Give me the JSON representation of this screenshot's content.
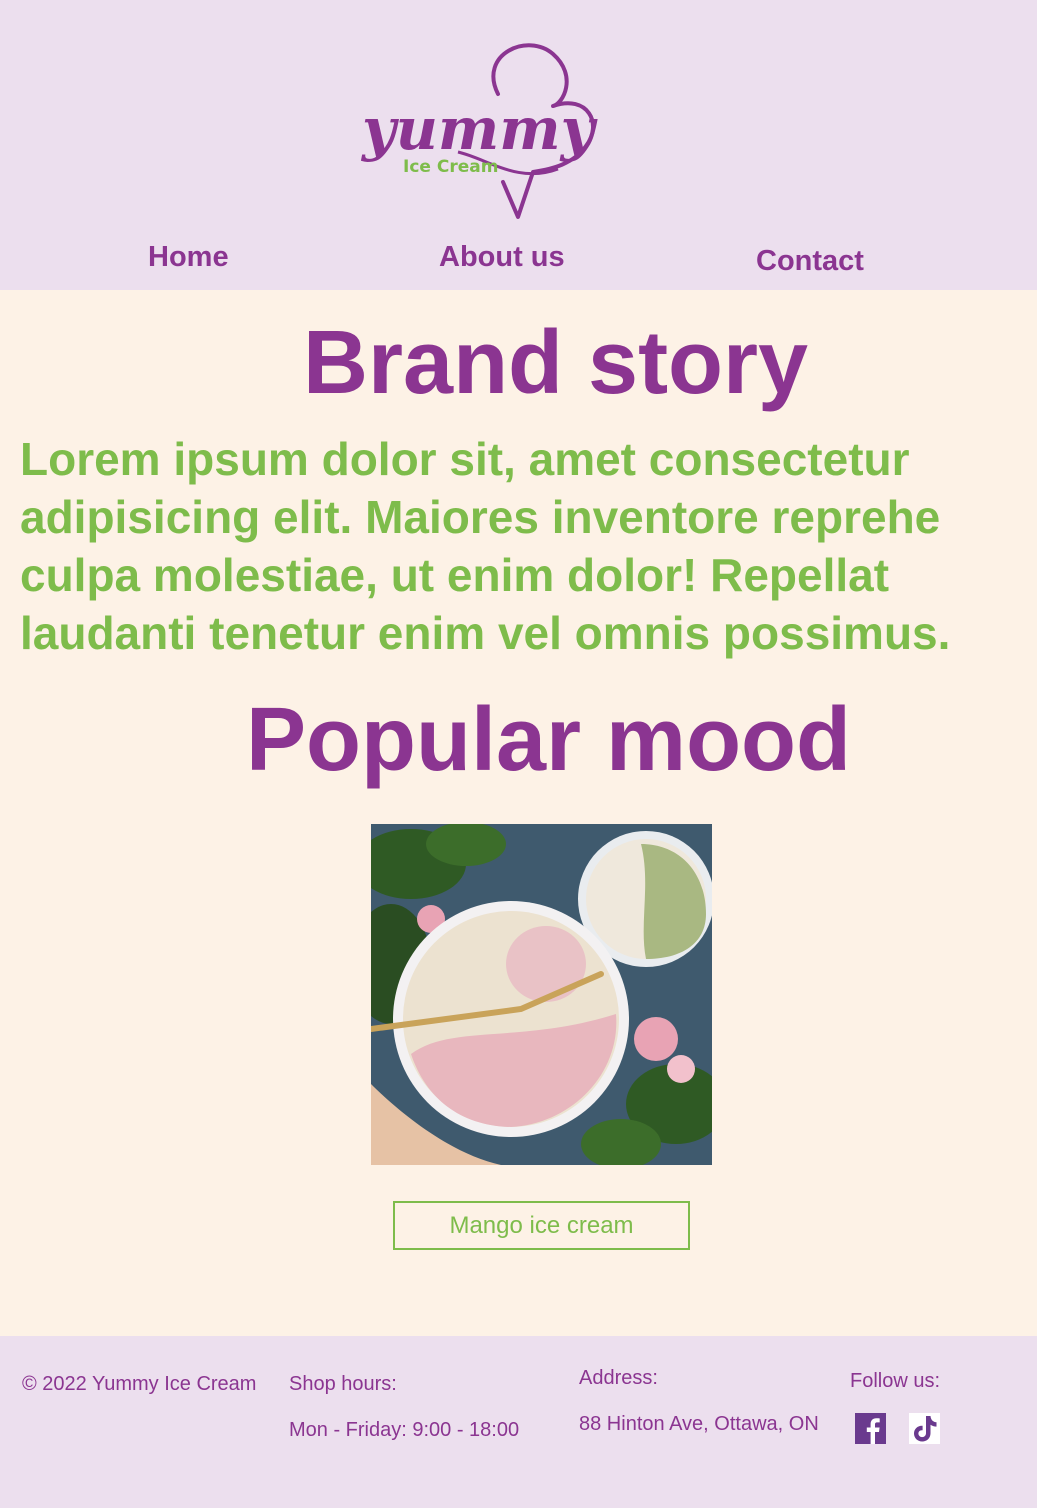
{
  "header": {
    "logo": {
      "wordmark": "yummy",
      "tagline": "Ice Cream"
    },
    "nav": [
      {
        "label": "Home"
      },
      {
        "label": "About us"
      },
      {
        "label": "Contact"
      }
    ]
  },
  "main": {
    "brand_title": "Brand story",
    "brand_text": [
      "Lorem ipsum dolor sit, amet consectetur",
      "adipisicing elit. Maiores inventore reprehe",
      "culpa molestiae, ut enim dolor! Repellat",
      "laudanti tenetur enim vel omnis possimus."
    ],
    "popular_title": "Popular mood",
    "product_button": "Mango ice cream"
  },
  "footer": {
    "copyright": "© 2022 Yummy Ice Cream",
    "hours_label": "Shop hours:",
    "hours_value": "Mon - Friday: 9:00 - 18:00",
    "address_label": "Address:",
    "address_value": "88 Hinton Ave, Ottawa, ON",
    "follow_label": "Follow us:",
    "social": [
      {
        "icon": "facebook-icon"
      },
      {
        "icon": "tiktok-icon"
      }
    ]
  },
  "colors": {
    "header_bg": "#ecdfee",
    "page_bg": "#fdf2e6",
    "brand_purple": "#8b3591",
    "brand_green": "#7ebc4b"
  }
}
